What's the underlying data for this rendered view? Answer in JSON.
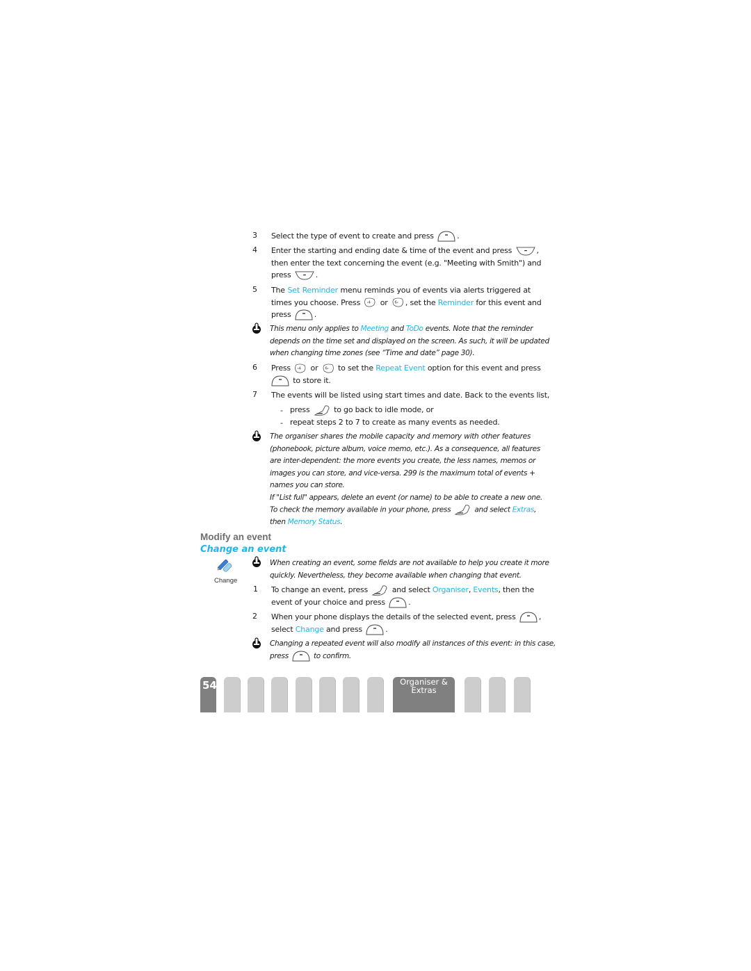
{
  "page": {
    "number": "54",
    "chapter_tab": {
      "line1": "Organiser &",
      "line2": "Extras"
    },
    "section_heading": "Modify an event",
    "subsection_heading": "Change an event",
    "side_icon": {
      "name": "change-icon",
      "label": "Change"
    }
  },
  "steps_create": [
    {
      "num": "3",
      "lines": [
        "Select the type of event to create and press",
        "."
      ],
      "key": "ok-key"
    },
    {
      "num": "4",
      "line1a": "Enter the starting and ending date & time of the event and press",
      "line1b": ",",
      "line2": "then enter the text concerning the event (e.g. \"Meeting with Smith\") and",
      "line3a": "press",
      "line3b": "."
    },
    {
      "num": "5",
      "line1a": "The",
      "link1": "Set Reminder",
      "line1b": "menu reminds you of events via alerts triggered at",
      "line2a": "times you choose. Press",
      "or": "or",
      "line2b": ", set the",
      "link2": "Reminder",
      "line2c": "for this event and",
      "line3a": "press",
      "line3b": "."
    }
  ],
  "note1": {
    "line1a": "This menu only applies to",
    "link1": "Meeting",
    "and": "and",
    "link2": "ToDo",
    "line1b": "events. Note that the reminder",
    "line2": "depends on the time set and displayed on the screen. As such, it will be updated",
    "line3": "when changing time zones (see “Time and date” page 30)."
  },
  "step6": {
    "num": "6",
    "line1a": "Press",
    "or": "or",
    "line1b": "to set the",
    "link": "Repeat Event",
    "line1c": "option for this event and press",
    "line2": "to store it."
  },
  "step7": {
    "num": "7",
    "line1": "The events will be listed using start times and date. Back to the events list,",
    "bullets": [
      {
        "dash": "-",
        "a": "press",
        "b": "to go back to idle mode, or"
      },
      {
        "dash": "-",
        "a": "repeat steps 2 to 7 to create as many events as needed."
      }
    ]
  },
  "note2": {
    "lines": [
      "The organiser shares the mobile capacity and memory with other features",
      "(phonebook, picture album, voice memo, etc.). As a consequence, all features",
      "are inter-dependent: the more events you create, the less names, memos or",
      "images you can store, and vice-versa. 299 is the maximum total of events +",
      "names you can store."
    ],
    "line6": "If \"List full\" appears, delete an event (or name) to be able to create a new one.",
    "line7a": "To check the memory available in your phone, press",
    "line7b": "and select",
    "link1": "Extras",
    "line7c": ",",
    "line8a": "then",
    "link2": "Memory Status",
    "line8b": "."
  },
  "note3": {
    "line1": "When creating an event, some fields are not available to help you create it more",
    "line2": "quickly.  Nevertheless, they become available when changing that event."
  },
  "steps_change": [
    {
      "num": "1",
      "line1a": "To change an event, press",
      "line1b": "and select",
      "link1": "Organiser",
      "comma": ",",
      "link2": "Events",
      "line1c": ", then the",
      "line2a": "event of your choice and press",
      "line2b": "."
    },
    {
      "num": "2",
      "line1a": "When your phone displays the details of the selected event, press",
      "line1b": ",",
      "line2a": "select",
      "link": "Change",
      "line2b": "and press",
      "line2c": "."
    }
  ],
  "note4": {
    "line1": "Changing a repeated event will also modify all instances of this event: in this case,",
    "line2a": "press",
    "line2b": "to confirm."
  },
  "colors": {
    "link": "#1fb6e8",
    "heading": "#6e6e6e",
    "tab_active": "#808080",
    "tab_inactive": "#cdcdcd"
  }
}
